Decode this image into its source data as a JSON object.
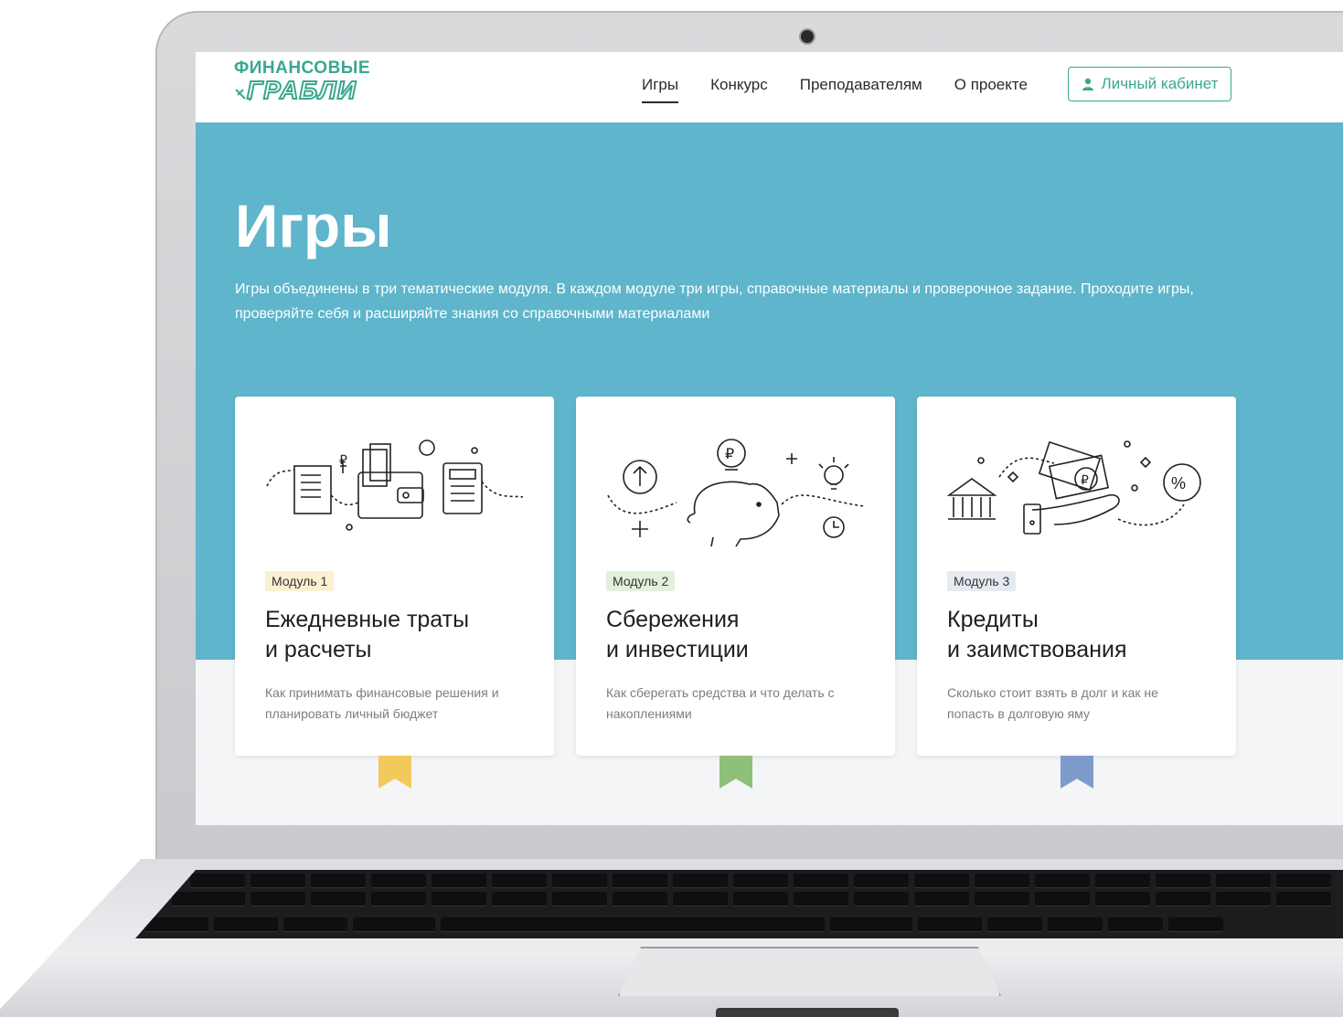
{
  "logo": {
    "line1": "ФИНАНСОВЫЕ",
    "line2": "ГРАБЛИ"
  },
  "nav": {
    "items": [
      {
        "label": "Игры",
        "active": true
      },
      {
        "label": "Конкурс",
        "active": false
      },
      {
        "label": "Преподавателям",
        "active": false
      },
      {
        "label": "О проекте",
        "active": false
      }
    ],
    "cabinet_label": "Личный кабинет"
  },
  "hero": {
    "title": "Игры",
    "text": "Игры объединены в три тематические модуля. В каждом модуле три игры, справочные материалы и проверочное задание. Проходите игры, проверяйте себя и расширяйте знания со справочными материалами"
  },
  "modules": [
    {
      "badge": "Модуль 1",
      "title_line1": "Ежедневные траты",
      "title_line2": "и расчеты",
      "desc": "Как принимать финансовые решения и планировать личный бюджет",
      "badge_color": "#fbf0d2",
      "ribbon_color": "#f2c95b",
      "icon": "wallet-budget-icon"
    },
    {
      "badge": "Модуль 2",
      "title_line1": "Сбережения",
      "title_line2": "и инвестиции",
      "desc": "Как сберегать средства и что делать с накоплениями",
      "badge_color": "#e3f0dd",
      "ribbon_color": "#8fc07a",
      "icon": "piggy-bank-icon"
    },
    {
      "badge": "Модуль 3",
      "title_line1": "Кредиты",
      "title_line2": "и заимствования",
      "desc": "Сколько стоит взять в долг и как не попасть в долговую яму",
      "badge_color": "#e6ebf2",
      "ribbon_color": "#7e9ccb",
      "icon": "credit-bank-icon"
    }
  ],
  "colors": {
    "brand": "#3aa78f",
    "hero": "#5fb5cb"
  }
}
